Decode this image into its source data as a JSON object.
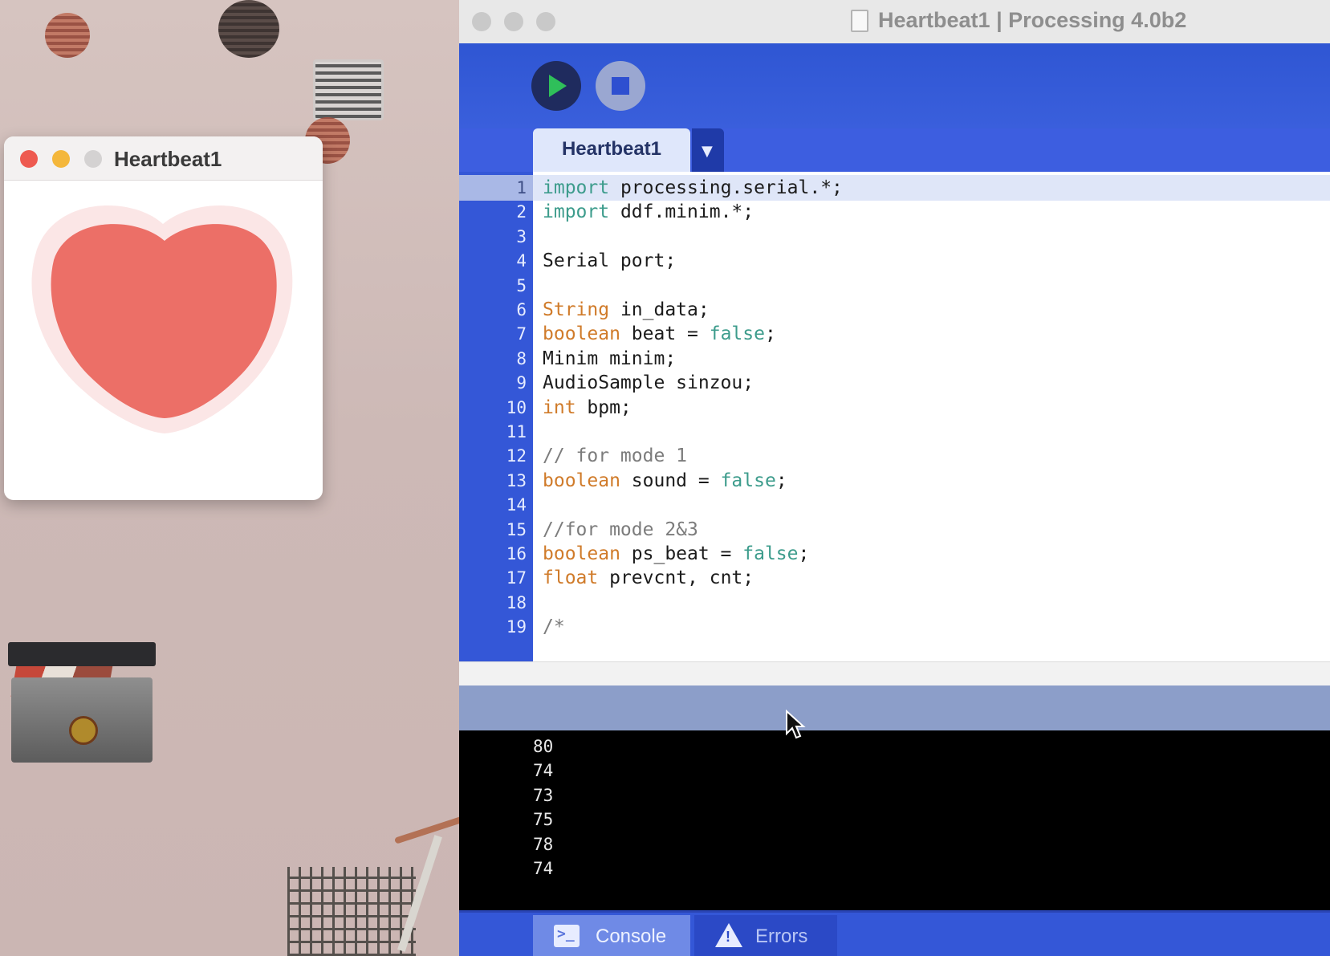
{
  "sketch_window": {
    "title": "Heartbeat1",
    "colors": {
      "heart": "#ec6f67",
      "glow": "#fbe6e6"
    }
  },
  "ide_window": {
    "title": "Heartbeat1 | Processing 4.0b2",
    "toolbar": {
      "run_icon": "play-icon",
      "stop_icon": "stop-icon"
    },
    "tab": {
      "label": "Heartbeat1",
      "menu_glyph": "▼"
    },
    "editor": {
      "active_line": 1,
      "lines": [
        {
          "n": "1",
          "tokens": [
            {
              "t": "import",
              "c": "kw"
            },
            {
              "t": " processing.serial.*;",
              "c": ""
            }
          ]
        },
        {
          "n": "2",
          "tokens": [
            {
              "t": "import",
              "c": "kw"
            },
            {
              "t": " ddf.minim.*;",
              "c": ""
            }
          ]
        },
        {
          "n": "3",
          "tokens": []
        },
        {
          "n": "4",
          "tokens": [
            {
              "t": "Serial port;",
              "c": ""
            }
          ]
        },
        {
          "n": "5",
          "tokens": []
        },
        {
          "n": "6",
          "tokens": [
            {
              "t": "String",
              "c": "type"
            },
            {
              "t": " in_data;",
              "c": ""
            }
          ]
        },
        {
          "n": "7",
          "tokens": [
            {
              "t": "boolean",
              "c": "type"
            },
            {
              "t": " beat = ",
              "c": ""
            },
            {
              "t": "false",
              "c": "lit"
            },
            {
              "t": ";",
              "c": ""
            }
          ]
        },
        {
          "n": "8",
          "tokens": [
            {
              "t": "Minim minim;",
              "c": ""
            }
          ]
        },
        {
          "n": "9",
          "tokens": [
            {
              "t": "AudioSample sinzou;",
              "c": ""
            }
          ]
        },
        {
          "n": "10",
          "tokens": [
            {
              "t": "int",
              "c": "type"
            },
            {
              "t": " bpm;",
              "c": ""
            }
          ]
        },
        {
          "n": "11",
          "tokens": []
        },
        {
          "n": "12",
          "tokens": [
            {
              "t": "// for mode 1",
              "c": "cmt"
            }
          ]
        },
        {
          "n": "13",
          "tokens": [
            {
              "t": "boolean",
              "c": "type"
            },
            {
              "t": " sound = ",
              "c": ""
            },
            {
              "t": "false",
              "c": "lit"
            },
            {
              "t": ";",
              "c": ""
            }
          ]
        },
        {
          "n": "14",
          "tokens": []
        },
        {
          "n": "15",
          "tokens": [
            {
              "t": "//for mode 2&3",
              "c": "cmt"
            }
          ]
        },
        {
          "n": "16",
          "tokens": [
            {
              "t": "boolean",
              "c": "type"
            },
            {
              "t": " ps_beat = ",
              "c": ""
            },
            {
              "t": "false",
              "c": "lit"
            },
            {
              "t": ";",
              "c": ""
            }
          ]
        },
        {
          "n": "17",
          "tokens": [
            {
              "t": "float",
              "c": "type"
            },
            {
              "t": " prevcnt, cnt;",
              "c": ""
            }
          ]
        },
        {
          "n": "18",
          "tokens": []
        },
        {
          "n": "19",
          "tokens": [
            {
              "t": "/*",
              "c": "cmt"
            }
          ]
        }
      ]
    },
    "console_output": [
      "80",
      "74",
      "73",
      "75",
      "78",
      "74"
    ],
    "bottom_tabs": {
      "console_label": "Console",
      "errors_label": "Errors"
    },
    "colors": {
      "accent": "#3457d7",
      "keyword": "#3d9c8c",
      "type": "#d07b2a",
      "comment": "#7c7c7c"
    }
  }
}
